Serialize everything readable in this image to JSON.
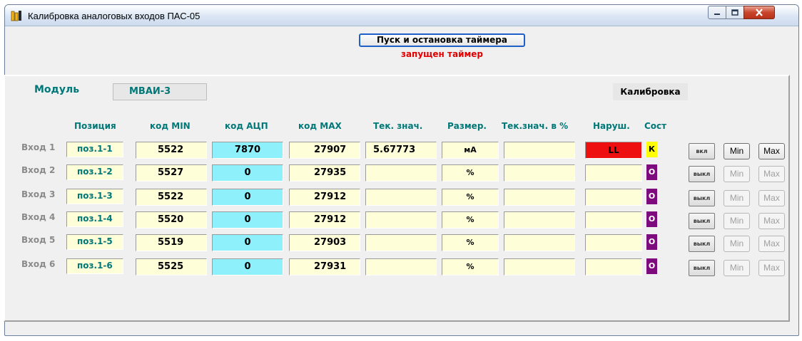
{
  "window": {
    "title": "Калибровка аналоговых входов ПАС-05"
  },
  "timer": {
    "button_label": "Пуск и остановка таймера",
    "status": "запущен таймер"
  },
  "module": {
    "label": "Модуль",
    "value": "МВАИ-3"
  },
  "calibration_label": "Калибровка",
  "columns": {
    "position": "Позиция",
    "code_min": "код MIN",
    "code_adc": "код  АЦП",
    "code_max": "код MAX",
    "current": "Тек. знач.",
    "unit": "Размер.",
    "current_pct": "Тек.знач. в %",
    "violation": "Наруш.",
    "state": "Сост"
  },
  "rows": [
    {
      "label": "Вход 1",
      "position": "поз.1-1",
      "code_min": "5522",
      "code_adc": "7870",
      "code_max": "27907",
      "current": "5.67773",
      "unit": "мА",
      "current_pct": "",
      "violation": "LL",
      "state": "К",
      "toggle": "вкл",
      "min": "Min",
      "max": "Max"
    },
    {
      "label": "Вход 2",
      "position": "поз.1-2",
      "code_min": "5527",
      "code_adc": "0",
      "code_max": "27935",
      "current": "",
      "unit": "%",
      "current_pct": "",
      "violation": "",
      "state": "О",
      "toggle": "выкл",
      "min": "Min",
      "max": "Max"
    },
    {
      "label": "Вход 3",
      "position": "поз.1-3",
      "code_min": "5522",
      "code_adc": "0",
      "code_max": "27912",
      "current": "",
      "unit": "%",
      "current_pct": "",
      "violation": "",
      "state": "О",
      "toggle": "выкл",
      "min": "Min",
      "max": "Max"
    },
    {
      "label": "Вход 4",
      "position": "поз.1-4",
      "code_min": "5520",
      "code_adc": "0",
      "code_max": "27912",
      "current": "",
      "unit": "%",
      "current_pct": "",
      "violation": "",
      "state": "О",
      "toggle": "выкл",
      "min": "Min",
      "max": "Max"
    },
    {
      "label": "Вход 5",
      "position": "поз.1-5",
      "code_min": "5519",
      "code_adc": "0",
      "code_max": "27903",
      "current": "",
      "unit": "%",
      "current_pct": "",
      "violation": "",
      "state": "О",
      "toggle": "выкл",
      "min": "Min",
      "max": "Max"
    },
    {
      "label": "Вход 6",
      "position": "поз.1-6",
      "code_min": "5525",
      "code_adc": "0",
      "code_max": "27931",
      "current": "",
      "unit": "%",
      "current_pct": "",
      "violation": "",
      "state": "О",
      "toggle": "выкл",
      "min": "Min",
      "max": "Max"
    }
  ],
  "colors": {
    "accent_text": "#007878",
    "adc_cell": "#8ef0fb",
    "value_cell": "#fefed8",
    "violation_alarm": "#ee1010",
    "state_k": "#ffff00",
    "state_o": "#7d0b7d",
    "timer_status": "#e00000"
  },
  "icons": {
    "app": "app-icon",
    "minimize": "minimize-icon",
    "maximize": "maximize-icon",
    "close": "close-icon"
  }
}
